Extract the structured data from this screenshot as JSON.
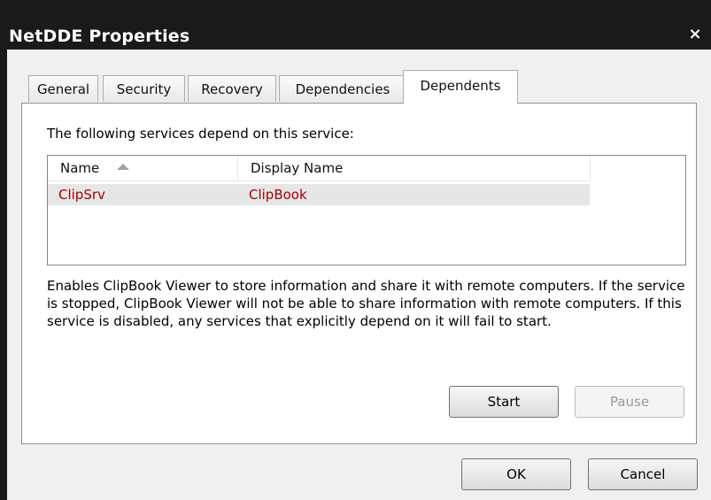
{
  "window": {
    "title": "NetDDE Properties",
    "close_glyph": "×"
  },
  "tabs": [
    {
      "label": "General",
      "active": false
    },
    {
      "label": "Security",
      "active": false
    },
    {
      "label": "Recovery",
      "active": false
    },
    {
      "label": "Dependencies",
      "active": false
    },
    {
      "label": "Dependents",
      "active": true
    }
  ],
  "panel": {
    "intro": "The following services depend on this service:",
    "list": {
      "columns": [
        "Name",
        "Display Name"
      ],
      "sort_indicator": "ascending",
      "rows": [
        {
          "name": "ClipSrv",
          "display_name": "ClipBook"
        }
      ]
    },
    "description": "Enables ClipBook Viewer to store information and share it with remote computers. If the service is stopped, ClipBook Viewer will not be able to share information with remote computers. If this service is disabled, any services that explicitly depend on it will fail to start.",
    "buttons": {
      "start": "Start",
      "pause": "Pause"
    }
  },
  "footer": {
    "ok": "OK",
    "cancel": "Cancel"
  },
  "colors": {
    "titlebar": "#1a1a1a",
    "dependent_text": "#a50000",
    "dialog_bg": "#f0f0f0"
  }
}
